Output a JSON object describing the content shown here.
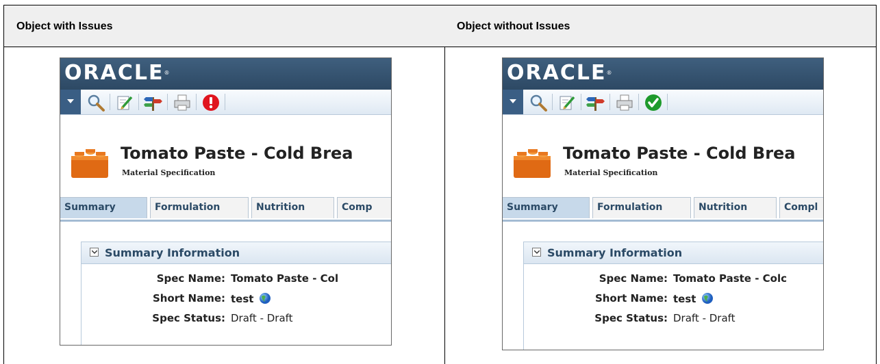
{
  "table": {
    "col_left_header": "Object with Issues",
    "col_right_header": "Object without Issues"
  },
  "screens": [
    {
      "logo": "ORACLE",
      "status_icon": "error-icon",
      "status_color": "#e0141e",
      "title": "Tomato Paste - Cold Brea",
      "subtitle": "Material Specification",
      "tabs": [
        "Summary",
        "Formulation",
        "Nutrition",
        "Comp"
      ],
      "section_title": "Summary Information",
      "fields": [
        {
          "label": "Spec Name:",
          "value": "Tomato Paste - Col"
        },
        {
          "label": "Short Name:",
          "value": "test"
        },
        {
          "label": "Spec Status:",
          "value": "Draft - Draft"
        }
      ]
    },
    {
      "logo": "ORACLE",
      "status_icon": "check-icon",
      "status_color": "#1e9a2c",
      "title": "Tomato Paste - Cold Brea",
      "subtitle": "Material Specification",
      "tabs": [
        "Summary",
        "Formulation",
        "Nutrition",
        "Compl"
      ],
      "section_title": "Summary Information",
      "fields": [
        {
          "label": "Spec Name:",
          "value": "Tomato Paste - Colc"
        },
        {
          "label": "Short Name:",
          "value": "test"
        },
        {
          "label": "Spec Status:",
          "value": "Draft - Draft"
        }
      ]
    }
  ]
}
